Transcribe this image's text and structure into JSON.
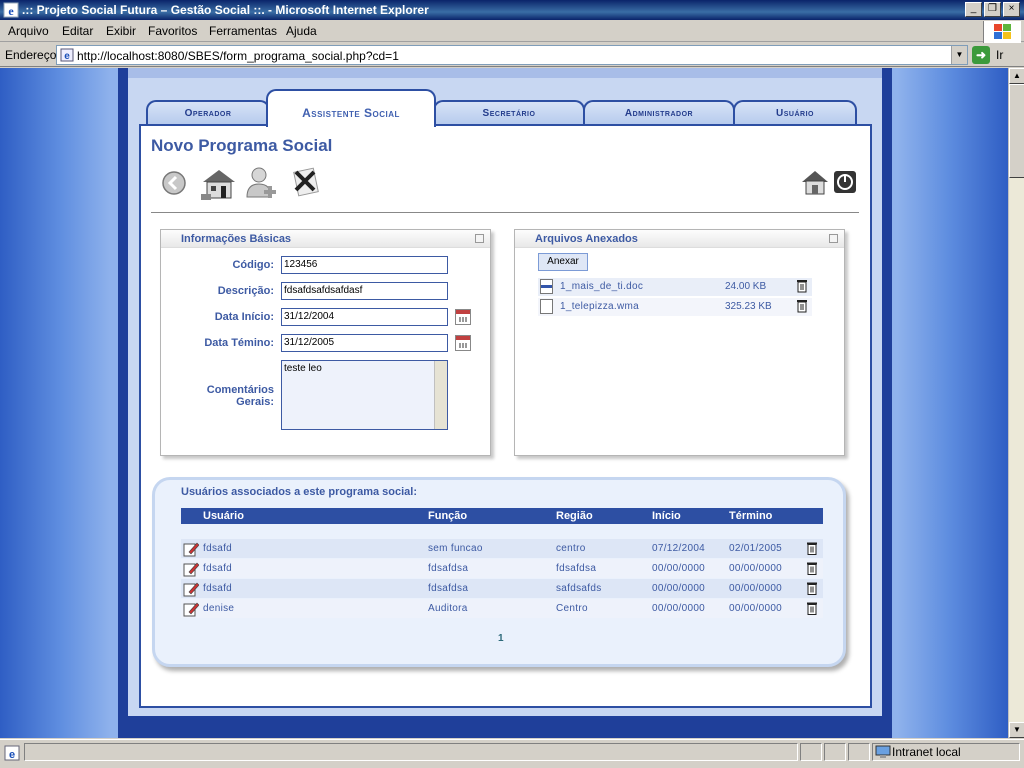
{
  "window": {
    "title": ".:: Projeto Social Futura – Gestão Social ::. - Microsoft Internet Explorer",
    "buttons": [
      "_",
      "❐",
      "×"
    ]
  },
  "menu": [
    "Arquivo",
    "Editar",
    "Exibir",
    "Favoritos",
    "Ferramentas",
    "Ajuda"
  ],
  "address": {
    "label": "Endereço",
    "url": "http://localhost:8080/SBES/form_programa_social.php?cd=1",
    "go_label": "Ir"
  },
  "tabs": [
    "Operador",
    "Assistente Social",
    "Secretário",
    "Administrador",
    "Usuário"
  ],
  "active_tab": "Assistente Social",
  "page": {
    "title": "Novo Programa Social",
    "toolbar_icons": [
      "back-icon",
      "building-icon",
      "add-user-icon",
      "delete-icon"
    ],
    "right_icons": [
      "home-icon",
      "power-icon"
    ]
  },
  "basic_info": {
    "title": "Informações Básicas",
    "fields": {
      "codigo": {
        "label": "Código:",
        "value": "123456"
      },
      "descricao": {
        "label": "Descrição:",
        "value": "fdsafdsafdsafdasf"
      },
      "data_inicio": {
        "label": "Data Início:",
        "value": "31/12/2004"
      },
      "data_termino": {
        "label": "Data Témino:",
        "value": "31/12/2005"
      },
      "comentarios": {
        "label1": "Comentários",
        "label2": "Gerais:",
        "value": "teste leo"
      }
    }
  },
  "attachments": {
    "title": "Arquivos Anexados",
    "button": "Anexar",
    "files": [
      {
        "name": "1_mais_de_ti.doc",
        "size": "24.00 KB"
      },
      {
        "name": "1_telepizza.wma",
        "size": "325.23 KB"
      }
    ]
  },
  "users": {
    "title": "Usuários associados a este programa social:",
    "columns": [
      "Usuário",
      "Função",
      "Região",
      "Início",
      "Término"
    ],
    "rows": [
      {
        "usuario": "fdsafd",
        "funcao": "sem funcao",
        "regiao": "centro",
        "inicio": "07/12/2004",
        "termino": "02/01/2005"
      },
      {
        "usuario": "fdsafd",
        "funcao": "fdsafdsa",
        "regiao": "fdsafdsa",
        "inicio": "00/00/0000",
        "termino": "00/00/0000"
      },
      {
        "usuario": "fdsafd",
        "funcao": "fdsafdsa",
        "regiao": "safdsafds",
        "inicio": "00/00/0000",
        "termino": "00/00/0000"
      },
      {
        "usuario": "denise",
        "funcao": "Auditora",
        "regiao": "Centro",
        "inicio": "00/00/0000",
        "termino": "00/00/0000"
      }
    ],
    "page": "1"
  },
  "status": {
    "zone": "Intranet local"
  },
  "colors": {
    "accent": "#2d4fa3",
    "text": "#3d5aa3",
    "titlebar": "#0a246a"
  }
}
